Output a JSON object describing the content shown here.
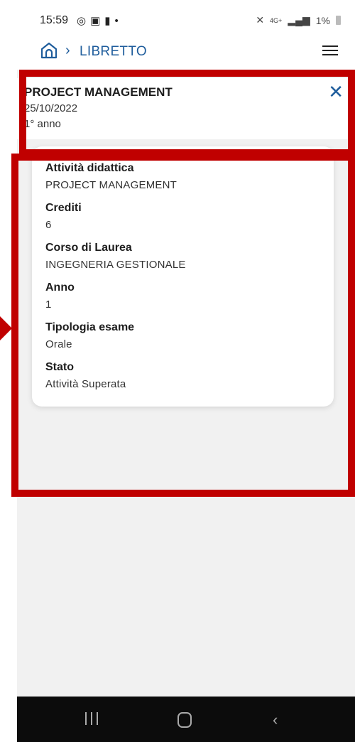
{
  "status_bar": {
    "time": "15:59",
    "left_icons": [
      "whatsapp-icon",
      "gallery-icon",
      "lock-icon",
      "dot-icon"
    ],
    "battery": "1%",
    "network": "4G+"
  },
  "header": {
    "breadcrumb_sep": "›",
    "breadcrumb": "LIBRETTO"
  },
  "detail": {
    "title": "PROJECT MANAGEMENT",
    "date": "25/10/2022",
    "year": "1° anno",
    "close_label": "✕"
  },
  "card": {
    "fields": [
      {
        "label": "Attività didattica",
        "value": "PROJECT MANAGEMENT"
      },
      {
        "label": "Crediti",
        "value": "6"
      },
      {
        "label": "Corso di Laurea",
        "value": "INGEGNERIA GESTIONALE"
      },
      {
        "label": "Anno",
        "value": "1"
      },
      {
        "label": "Tipologia esame",
        "value": "Orale"
      },
      {
        "label": "Stato",
        "value": "Attività Superata"
      }
    ]
  },
  "colors": {
    "accent": "#1f5d9c",
    "annotation": "#c00000",
    "background": "#f1f1f1"
  }
}
